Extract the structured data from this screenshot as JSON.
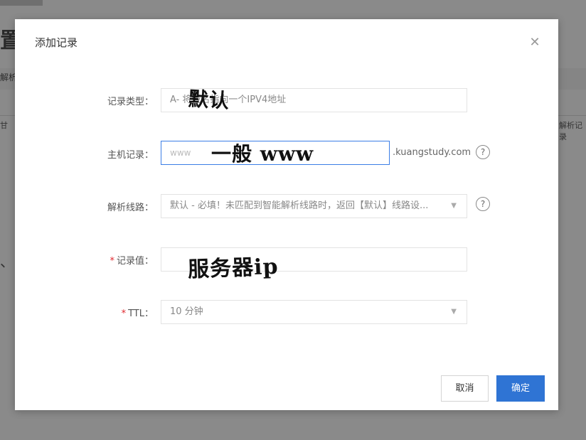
{
  "background": {
    "title": "置",
    "tab": "解析",
    "column": "甘",
    "right_text": "解析记录",
    "dash": "、"
  },
  "modal": {
    "title": "添加记录",
    "close_icon": "close-icon"
  },
  "form": {
    "record_type": {
      "label": "记录类型：",
      "value": "A- 将域名指向一个IPV4地址"
    },
    "host_record": {
      "label": "主机记录：",
      "value": "www",
      "suffix": ".kuangstudy.com",
      "help_icon": "question-circle-icon"
    },
    "resolution_line": {
      "label": "解析线路：",
      "value": "默认 - 必填！未匹配到智能解析线路时，返回【默认】线路设...",
      "help_icon": "question-circle-icon"
    },
    "record_value": {
      "required_mark": "*",
      "label": "记录值：",
      "value": ""
    },
    "ttl": {
      "required_mark": "*",
      "label": "TTL：",
      "value": "10 分钟"
    }
  },
  "annotations": {
    "note_default": "默认",
    "note_host": "一般 www",
    "note_value": "服务器ip"
  },
  "footer": {
    "cancel_label": "取消",
    "confirm_label": "确定"
  },
  "colors": {
    "primary": "#2f74d4",
    "required": "#e0282e",
    "focus_border": "#3b7ee6"
  }
}
